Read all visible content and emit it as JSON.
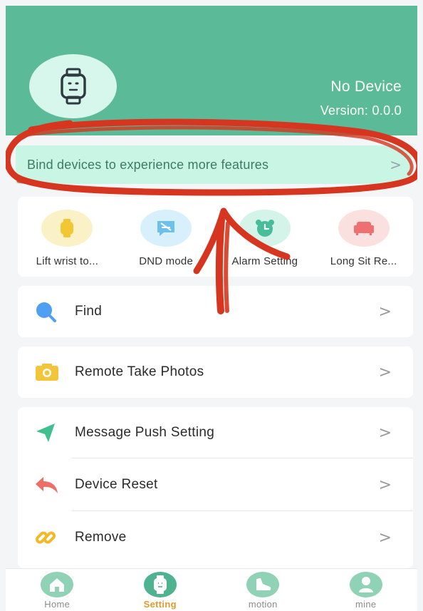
{
  "device": {
    "name": "No Device",
    "version": "Version: 0.0.0"
  },
  "bind_banner": {
    "text": "Bind devices to experience more features"
  },
  "quick_actions": [
    {
      "label": "Lift wrist to...",
      "icon": "watch-icon",
      "color": "#f7d85a",
      "bg": "#fbf1c6"
    },
    {
      "label": "DND mode",
      "icon": "dnd-message-icon",
      "color": "#7cc7ea",
      "bg": "#d8f0fb"
    },
    {
      "label": "Alarm Setting",
      "icon": "alarm-clock-icon",
      "color": "#4fc1a0",
      "bg": "#d4f3e9"
    },
    {
      "label": "Long Sit Re...",
      "icon": "sofa-icon",
      "color": "#f07b7b",
      "bg": "#fbe0e0"
    }
  ],
  "menu": {
    "find": "Find",
    "remote_photos": "Remote Take Photos",
    "message_push": "Message Push Setting",
    "device_reset": "Device Reset",
    "remove": "Remove"
  },
  "chevron": ">",
  "tabs": [
    {
      "label": "Home",
      "icon": "home-icon",
      "active": false
    },
    {
      "label": "Setting",
      "icon": "watch-icon",
      "active": true
    },
    {
      "label": "motion",
      "icon": "shoe-icon",
      "active": false
    },
    {
      "label": "mine",
      "icon": "person-icon",
      "active": false
    }
  ],
  "colors": {
    "header": "#5bbb98",
    "banner": "#c9f5e5",
    "active_tab": "#e19a2f",
    "annotation": "#d6361f"
  }
}
